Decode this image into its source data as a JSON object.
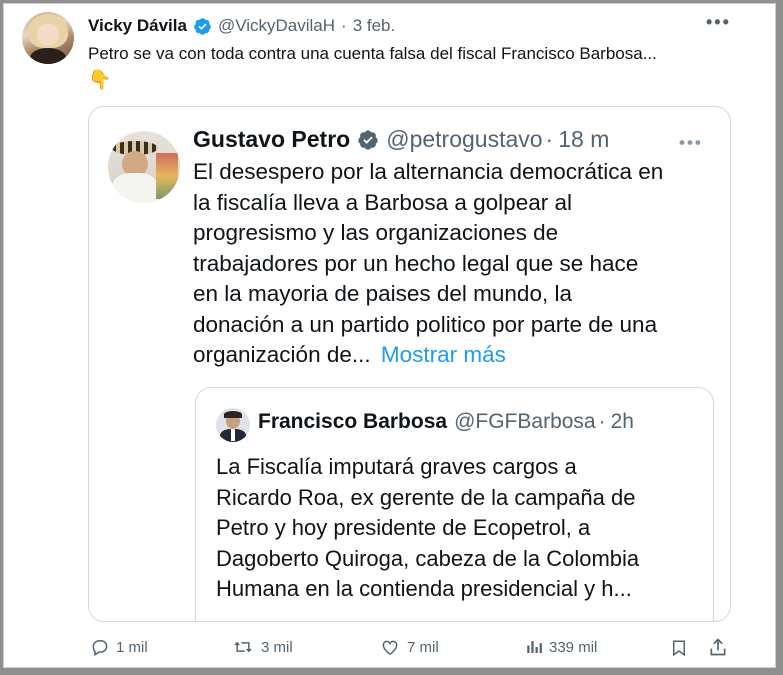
{
  "tweet": {
    "author_name": "Vicky Dávila",
    "handle": "@VickyDavilaH",
    "separator": "·",
    "date": "3 feb.",
    "more_icon": "more-dots-icon",
    "text": "Petro se va con toda contra una cuenta falsa del fiscal Francisco Barbosa...",
    "emoji": "👇"
  },
  "quoted": {
    "author_name": "Gustavo Petro",
    "handle": "@petrogustavo",
    "separator": "·",
    "time": "18 m",
    "lines": [
      "El desespero por la alternancia democrática en",
      "la fiscalía lleva a  Barbosa a golpear al",
      "progresismo y las organizaciones de",
      "trabajadores por un hecho legal que se hace",
      "en la mayoria de paises del mundo, la",
      "donación a un partido politico por parte de una"
    ],
    "last_line": "organización de...",
    "show_more": "Mostrar más"
  },
  "nested": {
    "author_name": "Francisco Barbosa",
    "handle": "@FGFBarbosa",
    "separator": "·",
    "time": "2h",
    "lines": [
      "La Fiscalía imputará graves cargos a",
      "Ricardo Roa, ex gerente de la campaña de",
      "Petro y hoy presidente de Ecopetrol, a",
      "Dagoberto Quiroga, cabeza de la Colombia",
      "Humana en la contienda presidencial y h..."
    ]
  },
  "actions": {
    "replies": "1 mil",
    "retweets": "3 mil",
    "likes": "7 mil",
    "views": "339 mil"
  },
  "colors": {
    "verified": "#1d9bf0",
    "link": "#1d9bf0",
    "text": "#0f1419",
    "muted": "#536471"
  }
}
